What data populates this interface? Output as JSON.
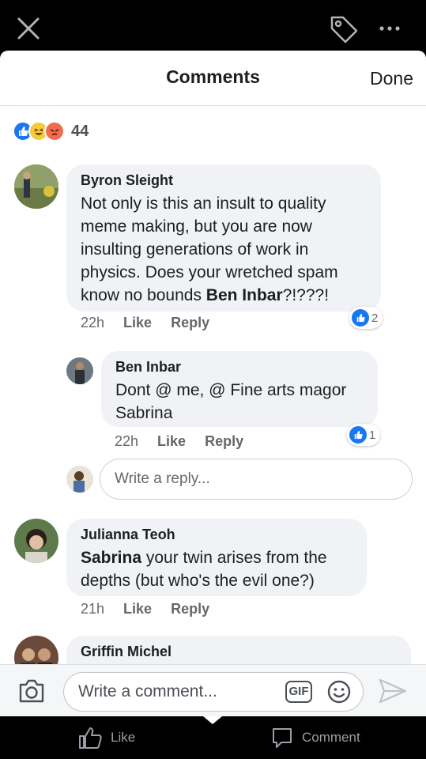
{
  "header": {
    "title": "Comments",
    "done_label": "Done"
  },
  "reactions": {
    "count": "44",
    "icons": [
      "like-reaction-icon",
      "haha-reaction-icon",
      "angry-reaction-icon"
    ]
  },
  "comments": [
    {
      "author": "Byron Sleight",
      "text": "Not only is this an insult to quality meme making, but you are now insulting generations of work in physics. Does your wretched spam know no bounds ",
      "mention": "Ben Inbar",
      "text_after": "?!???!",
      "time": "22h",
      "like_label": "Like",
      "reply_label": "Reply",
      "likes": "2"
    },
    {
      "author": "Ben Inbar",
      "text": "Dont @ me, @ Fine arts magor Sabrina",
      "time": "22h",
      "like_label": "Like",
      "reply_label": "Reply",
      "likes": "1"
    },
    {
      "author": "Julianna Teoh",
      "mention": "Sabrina",
      "text": " your twin arises from the depths (but who's the evil one?)",
      "time": "21h",
      "like_label": "Like",
      "reply_label": "Reply"
    },
    {
      "author": "Griffin Michel"
    }
  ],
  "reply_input": {
    "placeholder": "Write a reply..."
  },
  "composer": {
    "placeholder": "Write a comment...",
    "gif_label": "GIF"
  },
  "bottom_bar": {
    "like_label": "Like",
    "comment_label": "Comment"
  },
  "colors": {
    "accent": "#1877f2",
    "bubble": "#f0f2f5"
  }
}
